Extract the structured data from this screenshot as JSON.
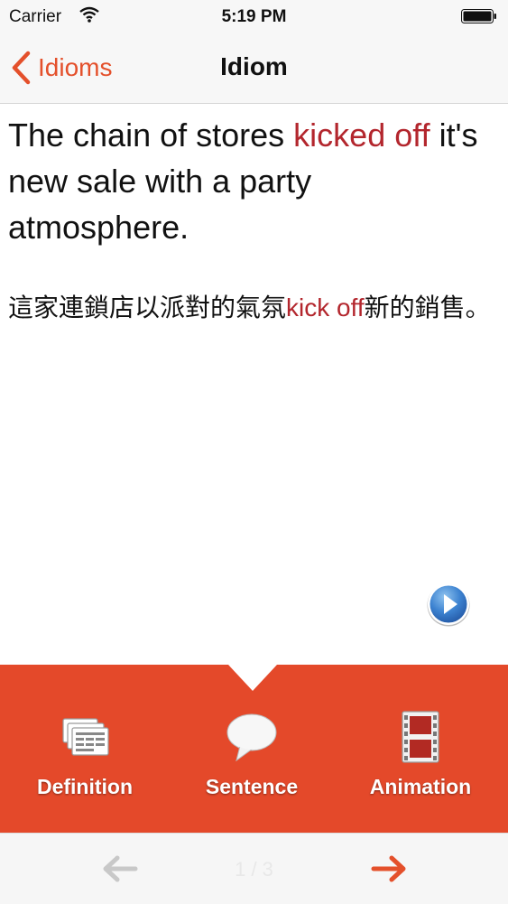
{
  "status_bar": {
    "carrier": "Carrier",
    "time": "5:19 PM"
  },
  "nav": {
    "back_label": "Idioms",
    "title": "Idiom",
    "accent_color": "#e4502b"
  },
  "content": {
    "sentence_en_before": "The chain of stores ",
    "sentence_en_highlight": "kicked off",
    "sentence_en_after": " it's new sale with a party atmosphere.",
    "sentence_zh_before": "這家連鎖店以派對的氣氛",
    "sentence_zh_highlight": "kick off",
    "sentence_zh_after": "新的銷售。",
    "highlight_color": "#b3262d"
  },
  "tabs": [
    {
      "label": "Definition",
      "icon": "definition-cards-icon"
    },
    {
      "label": "Sentence",
      "icon": "speech-bubble-icon"
    },
    {
      "label": "Animation",
      "icon": "film-strip-icon"
    }
  ],
  "tab_panel_color": "#e4492a",
  "pager": {
    "indicator": "1 / 3",
    "prev_icon": "arrow-left-icon",
    "next_icon": "arrow-right-icon"
  }
}
